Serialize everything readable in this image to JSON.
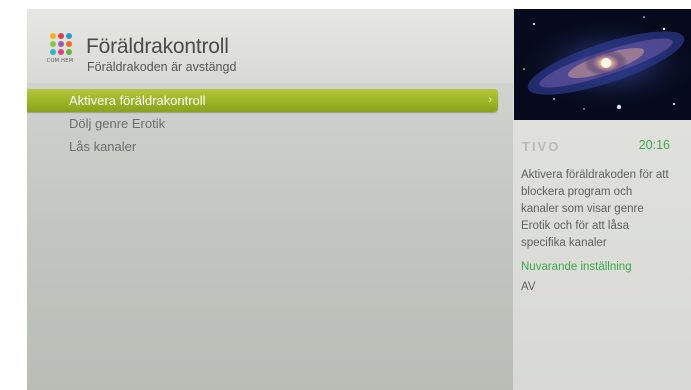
{
  "brand": {
    "name": "COM HEM",
    "dot_colors": [
      "#f6b21c",
      "#e2413d",
      "#2a9bd7",
      "#8cc63f",
      "#9b59b6",
      "#f36b21",
      "#27b7c7",
      "#e5407a",
      "#5db442"
    ]
  },
  "header": {
    "title": "Föräldrakontroll",
    "subtitle": "Föräldrakoden är avstängd"
  },
  "menu": {
    "items": [
      {
        "label": "Aktivera föräldrakontroll",
        "selected": true
      },
      {
        "label": "Dölj genre Erotik",
        "selected": false
      },
      {
        "label": "Lås kanaler",
        "selected": false
      }
    ],
    "chevron": "›"
  },
  "side": {
    "tivo_logo": "TIVO",
    "clock": "20:16",
    "description": "Aktivera föräldrakoden för att blockera program och kanaler som visar genre Erotik och för att låsa specifika kanaler",
    "current_setting_label": "Nuvarande inställning",
    "current_setting_value": "AV"
  },
  "colors": {
    "accent_green": "#9bb526",
    "status_green": "#3aa84a"
  },
  "icons": {
    "preview": "galaxy-preview-image",
    "chevron": "chevron-right-icon"
  }
}
